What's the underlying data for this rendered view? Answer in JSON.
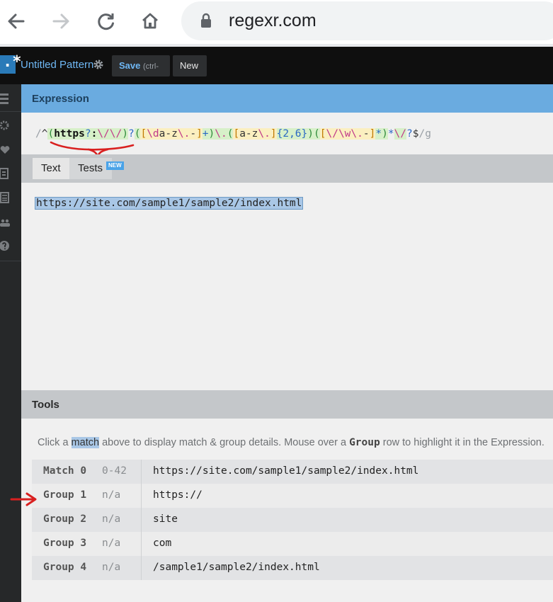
{
  "browser": {
    "url": "regexr.com",
    "back_icon": "arrow-left-icon",
    "forward_icon": "arrow-right-icon",
    "reload_icon": "reload-icon",
    "home_icon": "home-icon",
    "lock_icon": "lock-icon"
  },
  "app": {
    "logo_glyph": ".*",
    "pattern_name": "Untitled Pattern",
    "save_label": "Save",
    "save_shortcut": "(ctrl-s)",
    "new_label": "New",
    "accent_color": "#6aabe0"
  },
  "sidebar": {
    "icons": [
      "menu-icon",
      "gear-icon",
      "heart-icon",
      "book-icon",
      "document-icon",
      "community-icon",
      "help-icon"
    ]
  },
  "expression": {
    "header": "Expression",
    "tokens": [
      {
        "text": "/",
        "kind": "slash"
      },
      {
        "text": "^",
        "kind": "anchor"
      },
      {
        "text": "(",
        "kind": "grp"
      },
      {
        "text": "https",
        "kind": "lit"
      },
      {
        "text": "?",
        "kind": "q"
      },
      {
        "text": ":",
        "kind": "lit"
      },
      {
        "text": "\\/\\/",
        "kind": "esc"
      },
      {
        "text": ")",
        "kind": "grp"
      },
      {
        "text": "?",
        "kind": "quant"
      },
      {
        "text": "(",
        "kind": "grp"
      },
      {
        "text": "[",
        "kind": "set"
      },
      {
        "text": "\\d",
        "kind": "setesc"
      },
      {
        "text": "a-z",
        "kind": "range"
      },
      {
        "text": "\\.",
        "kind": "setesc"
      },
      {
        "text": "-",
        "kind": "range"
      },
      {
        "text": "]",
        "kind": "set"
      },
      {
        "text": "+",
        "kind": "q"
      },
      {
        "text": ")",
        "kind": "grp"
      },
      {
        "text": "\\.",
        "kind": "esc"
      },
      {
        "text": "(",
        "kind": "grp"
      },
      {
        "text": "[",
        "kind": "set"
      },
      {
        "text": "a-z",
        "kind": "range"
      },
      {
        "text": "\\.",
        "kind": "setesc"
      },
      {
        "text": "]",
        "kind": "set"
      },
      {
        "text": "{2,6}",
        "kind": "q"
      },
      {
        "text": ")",
        "kind": "grp"
      },
      {
        "text": "(",
        "kind": "grp"
      },
      {
        "text": "[",
        "kind": "set"
      },
      {
        "text": "\\/",
        "kind": "setesc"
      },
      {
        "text": "\\w",
        "kind": "setesc"
      },
      {
        "text": " ",
        "kind": "range"
      },
      {
        "text": "\\.",
        "kind": "setesc"
      },
      {
        "text": "-",
        "kind": "range"
      },
      {
        "text": "]",
        "kind": "set"
      },
      {
        "text": "*",
        "kind": "q"
      },
      {
        "text": ")",
        "kind": "grp"
      },
      {
        "text": "*",
        "kind": "quant"
      },
      {
        "text": "\\/",
        "kind": "esc"
      },
      {
        "text": "?",
        "kind": "quant"
      },
      {
        "text": "$",
        "kind": "anchor"
      },
      {
        "text": "/g",
        "kind": "flag"
      }
    ]
  },
  "tabs": [
    {
      "label": "Text"
    },
    {
      "label": "Tests",
      "badge": "NEW"
    }
  ],
  "text_input": {
    "value": "https://site.com/sample1/sample2/index.html"
  },
  "tools": {
    "header": "Tools",
    "info_1": "Click a ",
    "info_match": "match",
    "info_2": " above to display match & group details. Mouse over a ",
    "info_group": "Group",
    "info_3": " row to highlight it in the Expression.",
    "rows": [
      {
        "label": "Match 0",
        "range": "0-42",
        "value": "https://site.com/sample1/sample2/index.html"
      },
      {
        "label": "Group 1",
        "range": "n/a",
        "value": "https://"
      },
      {
        "label": "Group 2",
        "range": "n/a",
        "value": "site"
      },
      {
        "label": "Group 3",
        "range": "n/a",
        "value": "com"
      },
      {
        "label": "Group 4",
        "range": "n/a",
        "value": "/sample1/sample2/index.html"
      }
    ]
  },
  "annotations": {
    "color": "#d92020"
  }
}
